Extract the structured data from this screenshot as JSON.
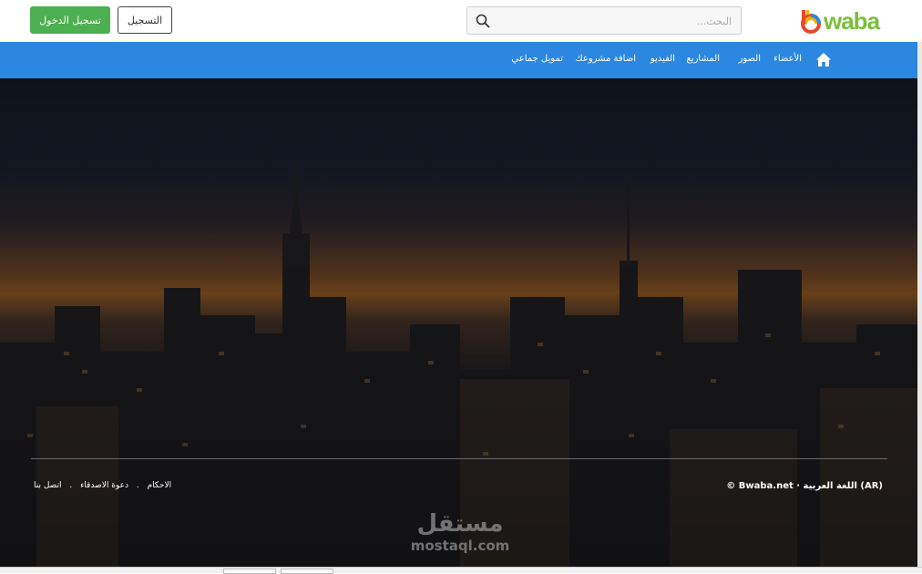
{
  "header": {
    "login_label": "تسجيل الدخول",
    "register_label": "التسجيل",
    "search_placeholder": "البحث...",
    "logo_text": "waba",
    "logo_mark": "b"
  },
  "nav": {
    "items": [
      {
        "label": "الأعضاء"
      },
      {
        "label": "الصور"
      },
      {
        "label": "المشاريع"
      },
      {
        "label": "الفيديو"
      },
      {
        "label": "اضافة مشروعك"
      },
      {
        "label": "تمويل جماعي"
      }
    ]
  },
  "footer": {
    "links": [
      "الاحكام",
      "دعوة الاصدقاء",
      "اتصل بنا"
    ],
    "separator": ".",
    "copyright": "© Bwaba.net · اللغة العربية (AR)"
  },
  "watermark": {
    "arabic": "مستقل",
    "latin": "mostaql.com"
  },
  "colors": {
    "login_button": "#4caf50",
    "navbar": "#2b87e0",
    "logo_green": "#7bbf3a"
  },
  "icons": {
    "search": "search-icon",
    "home": "home-icon"
  }
}
